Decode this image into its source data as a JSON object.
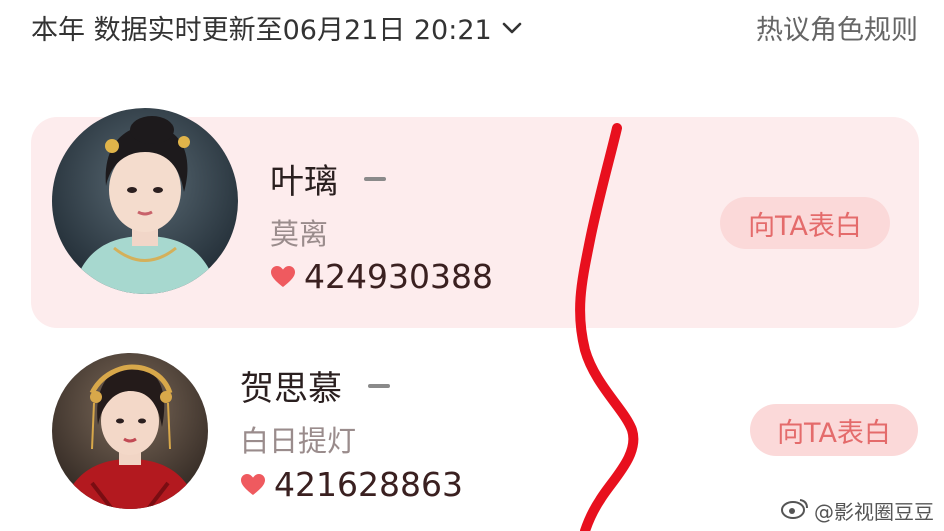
{
  "header": {
    "period_label": "本年 数据实时更新至06月21日 20:21",
    "rules_link": "热议角色规则"
  },
  "characters": [
    {
      "name": "叶璃",
      "rank_change": "—",
      "drama": "莫离",
      "votes": "424930388",
      "button_label": "向TA表白",
      "highlighted": true
    },
    {
      "name": "贺思慕",
      "rank_change": "—",
      "drama": "白日提灯",
      "votes": "421628863",
      "button_label": "向TA表白",
      "highlighted": false
    }
  ],
  "watermark": {
    "text": "@影视圈豆豆"
  },
  "colors": {
    "highlight_bg": "#fdeced",
    "button_bg": "#fbd9d9",
    "button_text": "#e46b6b",
    "heart": "#ef5a5f",
    "annotation_stroke": "#e8101e"
  }
}
